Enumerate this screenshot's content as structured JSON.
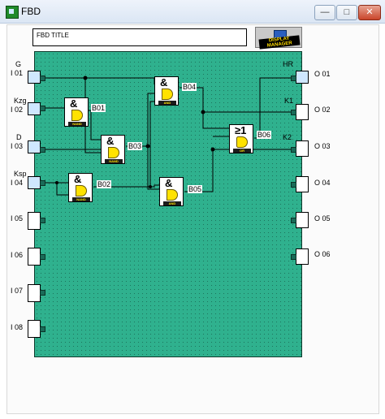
{
  "window": {
    "title": "FBD",
    "buttons": {
      "minimize": "—",
      "maximize": "□",
      "close": "✕"
    }
  },
  "toolbar": {
    "fbd_title": "FBD TITLE",
    "display_manager": "DISPLAY MANAGER"
  },
  "inputs": [
    {
      "id": "I 01",
      "name": "G"
    },
    {
      "id": "I 02",
      "name": "Kzg"
    },
    {
      "id": "I 03",
      "name": "D"
    },
    {
      "id": "I 04",
      "name": "Ksp"
    },
    {
      "id": "I 05",
      "name": ""
    },
    {
      "id": "I 06",
      "name": ""
    },
    {
      "id": "I 07",
      "name": ""
    },
    {
      "id": "I 08",
      "name": ""
    }
  ],
  "outputs": [
    {
      "id": "O 01",
      "name": "HR"
    },
    {
      "id": "O 02",
      "name": "K1"
    },
    {
      "id": "O 03",
      "name": "K2"
    },
    {
      "id": "O 04",
      "name": ""
    },
    {
      "id": "O 05",
      "name": ""
    },
    {
      "id": "O 06",
      "name": ""
    }
  ],
  "blocks": [
    {
      "label": "B01",
      "symbol": "&",
      "type": "NAND"
    },
    {
      "label": "B02",
      "symbol": "&",
      "type": "NAND"
    },
    {
      "label": "B03",
      "symbol": "&",
      "type": "NAND"
    },
    {
      "label": "B04",
      "symbol": "&",
      "type": "AND"
    },
    {
      "label": "B05",
      "symbol": "&",
      "type": "AND"
    },
    {
      "label": "B06",
      "symbol": "≥1",
      "type": "OR"
    }
  ]
}
